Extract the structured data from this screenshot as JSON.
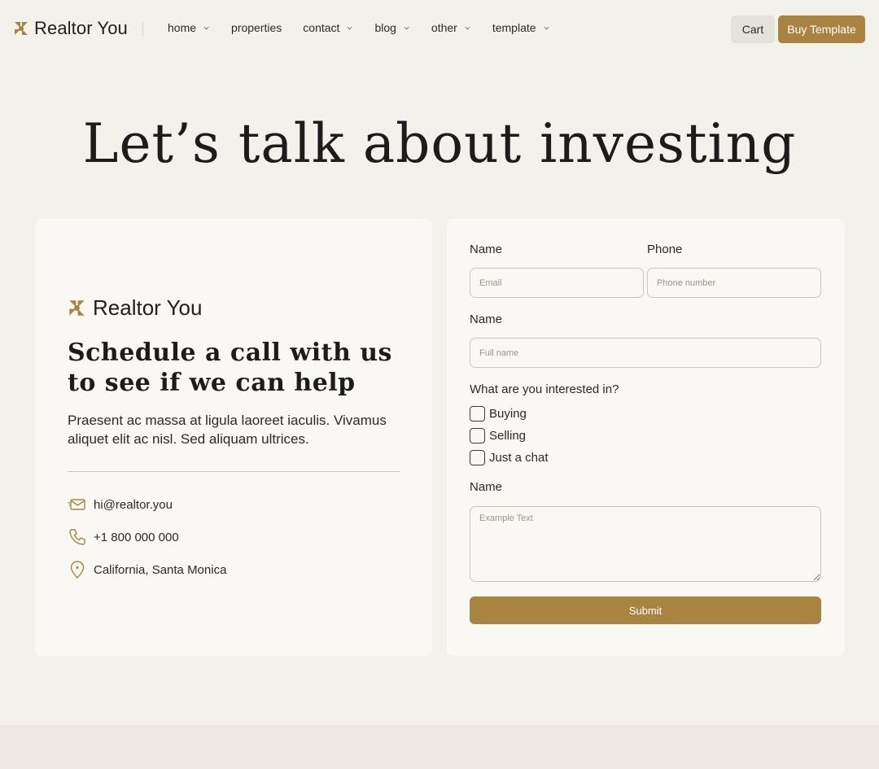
{
  "header": {
    "brand": "Realtor You",
    "nav": [
      {
        "label": "home",
        "dropdown": true
      },
      {
        "label": "properties",
        "dropdown": false
      },
      {
        "label": "contact",
        "dropdown": true
      },
      {
        "label": "blog",
        "dropdown": true
      },
      {
        "label": "other",
        "dropdown": true
      },
      {
        "label": "template",
        "dropdown": true
      }
    ],
    "cart_label": "Cart",
    "buy_label": "Buy Template"
  },
  "hero": {
    "title": "Let’s talk about investing"
  },
  "info_card": {
    "brand": "Realtor You",
    "heading": "Schedule a call with us to see if we can help",
    "description": "Praesent ac massa at ligula laoreet iaculis. Vivamus aliquet elit ac nisl. Sed aliquam ultrices.",
    "contacts": [
      {
        "icon": "mail-icon",
        "text": "hi@realtor.you"
      },
      {
        "icon": "phone-icon",
        "text": "+1 800 000 000"
      },
      {
        "icon": "location-pin-icon",
        "text": "California, Santa Monica"
      }
    ]
  },
  "form": {
    "email_label": "Name",
    "email_placeholder": "Email",
    "phone_label": "Phone",
    "phone_placeholder": "Phone number",
    "name_label": "Name",
    "name_placeholder": "Full name",
    "interest_label": "What are you interested in?",
    "options": [
      "Buying",
      "Selling",
      "Just a chat"
    ],
    "message_label": "Name",
    "message_placeholder": "Example Text",
    "submit_label": "Submit"
  },
  "colors": {
    "accent": "#a98340",
    "background": "#f3f1ec",
    "card": "#faf8f4"
  }
}
